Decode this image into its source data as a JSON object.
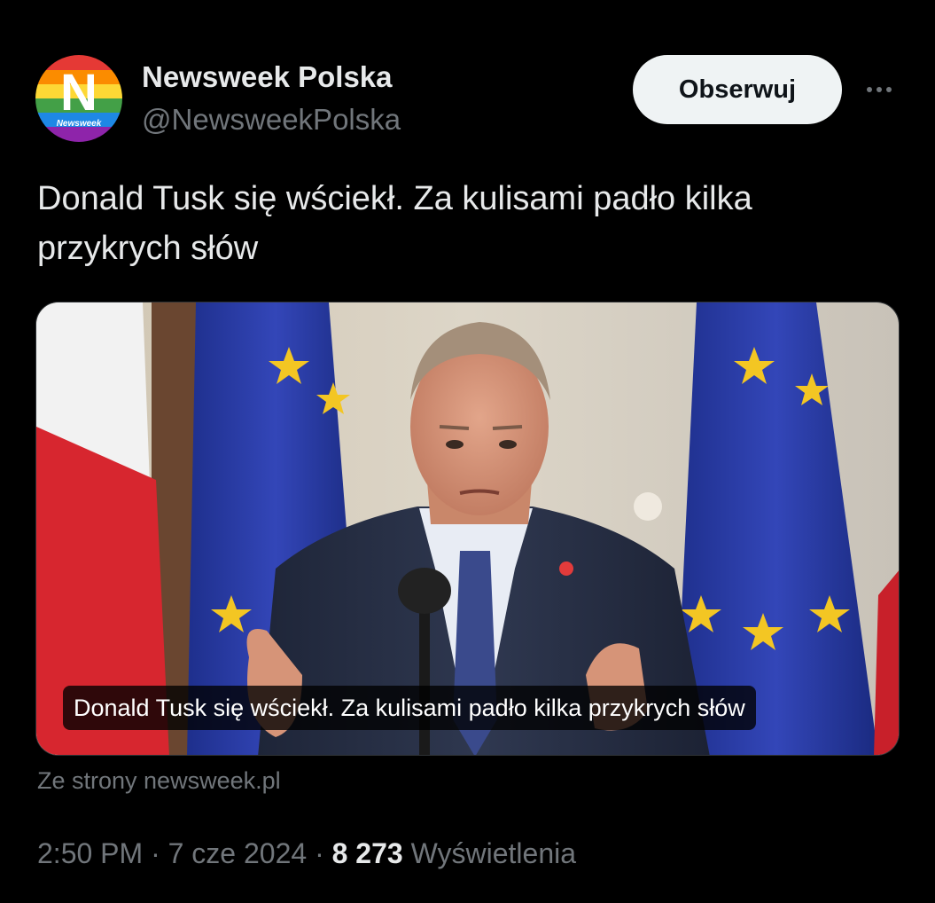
{
  "author": {
    "name": "Newsweek Polska",
    "handle": "@NewsweekPolska",
    "avatar_letter": "N",
    "avatar_wordmark": "Newsweek"
  },
  "actions": {
    "follow_label": "Obserwuj",
    "more_icon": "more-horizontal-icon"
  },
  "post": {
    "text": "Donald Tusk się wściekł. Za kulisami padło kilka przykrych słów"
  },
  "link_card": {
    "caption": "Donald Tusk się wściekł. Za kulisami padło kilka przykrych słów",
    "source": "Ze strony newsweek.pl"
  },
  "meta": {
    "time": "2:50 PM",
    "separator": "·",
    "date": "7 cze 2024",
    "views_count": "8 273",
    "views_label": "Wyświetlenia"
  },
  "colors": {
    "background": "#000000",
    "text_primary": "#e7e9ea",
    "text_secondary": "#71767b",
    "button_bg": "#eff3f4"
  }
}
